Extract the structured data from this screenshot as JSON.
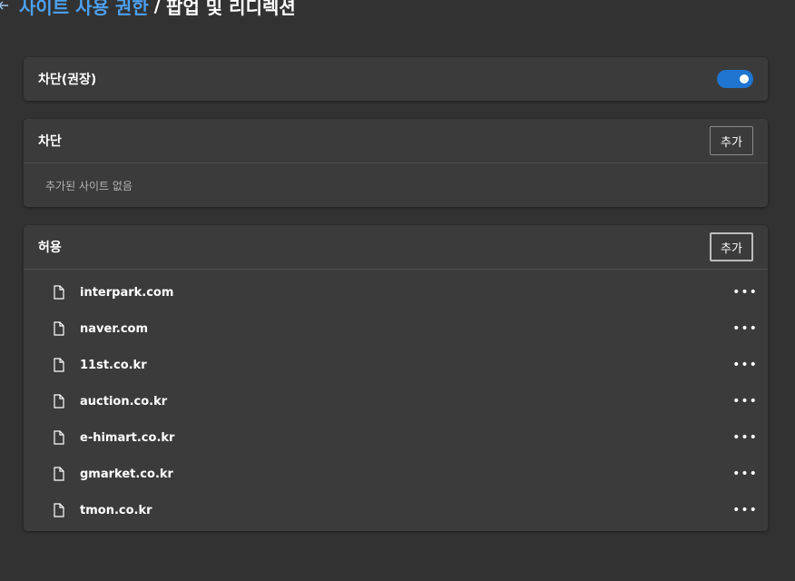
{
  "breadcrumb": {
    "parent": "사이트 사용 권한",
    "separator": "/",
    "current": "팝업 및 리디렉션"
  },
  "toggle_section": {
    "label": "차단(권장)",
    "enabled": true,
    "accent_color": "#1f75cf"
  },
  "block_section": {
    "title": "차단",
    "add_label": "추가",
    "empty_text": "추가된 사이트 없음"
  },
  "allow_section": {
    "title": "허용",
    "add_label": "추가",
    "sites": [
      {
        "name": "interpark.com"
      },
      {
        "name": "naver.com"
      },
      {
        "name": "11st.co.kr"
      },
      {
        "name": "auction.co.kr"
      },
      {
        "name": "e-himart.co.kr"
      },
      {
        "name": "gmarket.co.kr"
      },
      {
        "name": "tmon.co.kr"
      }
    ]
  },
  "icons": {
    "back": "arrow-left-icon",
    "site": "file-icon",
    "more": "more-horizontal-icon"
  }
}
